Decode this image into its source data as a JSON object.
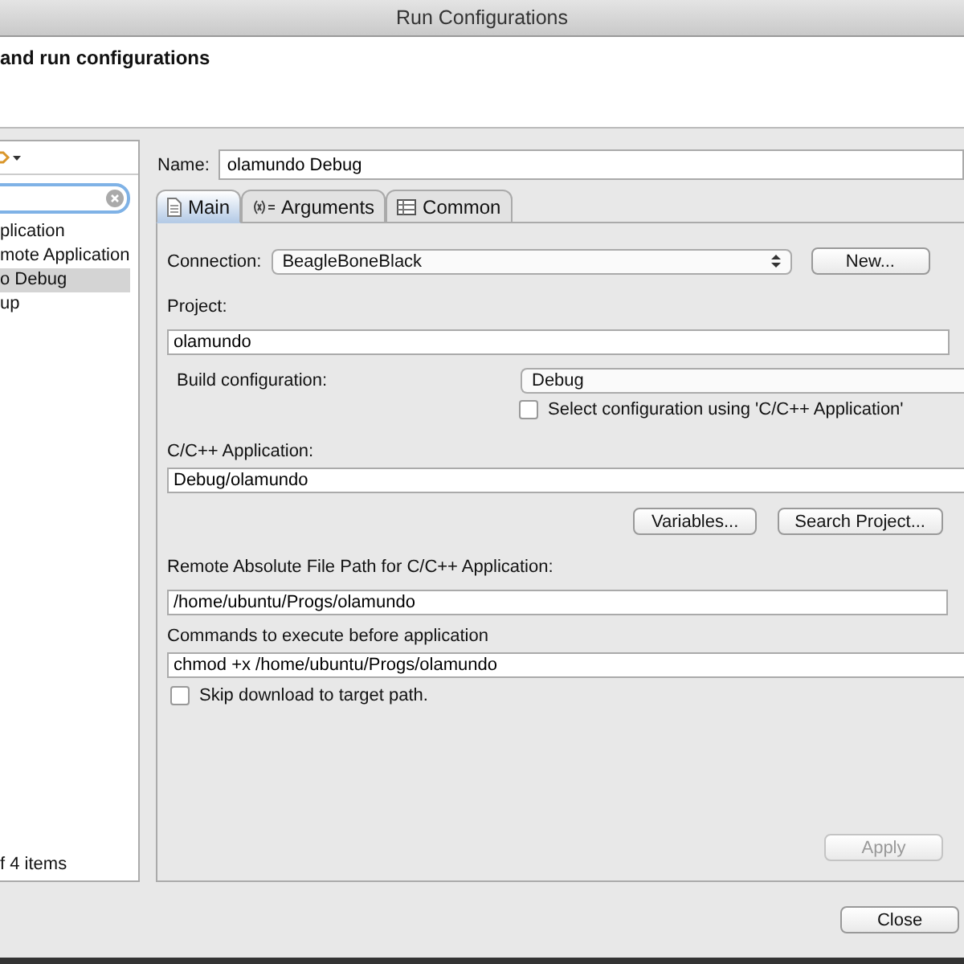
{
  "window": {
    "title": "Run Configurations"
  },
  "header": {
    "title": "and run configurations"
  },
  "sidebar": {
    "items": [
      {
        "label": "plication",
        "selected": false
      },
      {
        "label": "mote Application",
        "selected": false
      },
      {
        "label": "o Debug",
        "selected": true
      },
      {
        "label": "up",
        "selected": false
      }
    ],
    "status": "f 4 items"
  },
  "name_field": {
    "label": "Name:",
    "value": "olamundo Debug"
  },
  "tabs": [
    {
      "label": "Main",
      "selected": true
    },
    {
      "label": "Arguments",
      "selected": false
    },
    {
      "label": "Common",
      "selected": false
    }
  ],
  "main": {
    "connection": {
      "label": "Connection:",
      "value": "BeagleBoneBlack",
      "button": "New..."
    },
    "project": {
      "label": "Project:",
      "value": "olamundo"
    },
    "build": {
      "label": "Build configuration:",
      "value": "Debug",
      "checkbox": {
        "label": "Select configuration using 'C/C++ Application'",
        "checked": false
      }
    },
    "application": {
      "label": "C/C++ Application:",
      "value": "Debug/olamundo",
      "buttons": [
        "Variables...",
        "Search Project..."
      ]
    },
    "remote": {
      "label": "Remote Absolute File Path for C/C++ Application:",
      "value": "/home/ubuntu/Progs/olamundo"
    },
    "commands": {
      "label": "Commands to execute before application",
      "value": "chmod +x /home/ubuntu/Progs/olamundo"
    },
    "skip": {
      "label": "Skip download to target path.",
      "checked": false
    }
  },
  "apply": {
    "label": "Apply",
    "disabled": true
  },
  "close": {
    "label": "Close"
  }
}
